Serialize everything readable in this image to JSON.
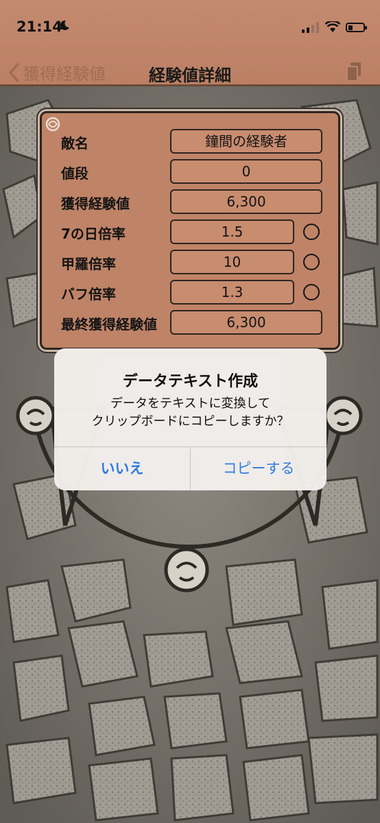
{
  "status_bar": {
    "time": "21:14"
  },
  "nav": {
    "back_label": "獲得経験値",
    "title": "経験値詳細"
  },
  "panel": {
    "rows": [
      {
        "label": "敵名",
        "value": "鐘間の経験者",
        "has_radio": false
      },
      {
        "label": "値段",
        "value": "0",
        "has_radio": false
      },
      {
        "label": "獲得経験値",
        "value": "6,300",
        "has_radio": false
      },
      {
        "label": "7の日倍率",
        "value": "1.5",
        "has_radio": true
      },
      {
        "label": "甲羅倍率",
        "value": "10",
        "has_radio": true
      },
      {
        "label": "バフ倍率",
        "value": "1.3",
        "has_radio": true
      },
      {
        "label": "最終獲得経験値",
        "value": "6,300",
        "has_radio": false
      }
    ]
  },
  "dialog": {
    "title": "データテキスト作成",
    "message_line1": "データをテキストに変換して",
    "message_line2": "クリップボードにコピーしますか？",
    "cancel_label": "いいえ",
    "confirm_label": "コピーする"
  },
  "colors": {
    "accent": "#2f7be0",
    "panel": "#bf8367",
    "header": "#c48a70"
  },
  "icons": [
    "moon-icon",
    "signal-icon",
    "wifi-icon",
    "battery-icon",
    "chevron-left-icon",
    "copy-document-icon",
    "app-logo-icon",
    "radio-circle-icon"
  ]
}
